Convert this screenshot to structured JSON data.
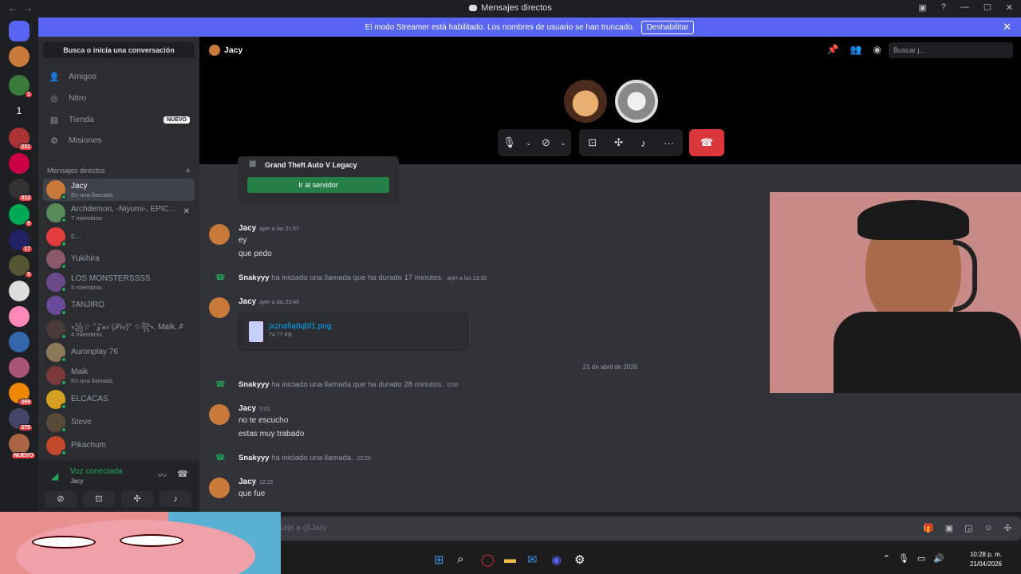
{
  "window": {
    "title": "Mensajes directos",
    "back": "←",
    "forward": "→"
  },
  "banner": {
    "text": "El modo Streamer está habilitado. Los nombres de usuario se han truncado.",
    "button": "Deshabilitar",
    "close": "✕"
  },
  "guilds": [
    {
      "badge": "",
      "color": "#5865f2"
    },
    {
      "badge": "",
      "color": "#c97a3a"
    },
    {
      "badge": "1",
      "color": "#3a7a3a"
    },
    {
      "badge": "",
      "label": "1",
      "color": "#1e1f22"
    },
    {
      "badge": "231",
      "color": "#a33"
    },
    {
      "badge": "",
      "color": "#c04"
    },
    {
      "badge": "312",
      "color": "#333"
    },
    {
      "badge": "5",
      "color": "#0a5"
    },
    {
      "badge": "17",
      "color": "#226"
    },
    {
      "badge": "5",
      "color": "#553"
    },
    {
      "badge": "",
      "color": "#ddd"
    },
    {
      "badge": "",
      "color": "#f8b"
    },
    {
      "badge": "",
      "color": "#36a"
    },
    {
      "badge": "",
      "color": "#a57"
    },
    {
      "badge": "369",
      "color": "#e80"
    },
    {
      "badge": "375",
      "color": "#446"
    },
    {
      "badge": "NUEVO",
      "color": "#a64"
    }
  ],
  "dm_sidebar": {
    "search": "Busca o inicia una conversación",
    "nav": [
      {
        "label": "Amigos",
        "icon": "person-icon"
      },
      {
        "label": "Nitro",
        "icon": "nitro-icon"
      },
      {
        "label": "Tienda",
        "icon": "shop-icon",
        "badge": "NUEVO"
      },
      {
        "label": "Misiones",
        "icon": "quests-icon"
      }
    ],
    "section": "Mensajes directos",
    "add": "+",
    "dms": [
      {
        "name": "Jacy",
        "sub": "En una llamada",
        "color": "#c97a3a",
        "active": true
      },
      {
        "name": "Archdemon, -Niyumi-, EPIC...",
        "sub": "7 miembros",
        "color": "#5a8a5a",
        "close": "✕"
      },
      {
        "name": "c...",
        "sub": "",
        "color": "#e23c3c"
      },
      {
        "name": "Yukihira",
        "sub": "",
        "color": "#8a5a6a"
      },
      {
        "name": "LOS MONSTERSSSS",
        "sub": "5 miembros",
        "color": "#6a4a8a"
      },
      {
        "name": "TANJIRO",
        "sub": "",
        "color": "#6a4a9a"
      },
      {
        "name": "꧁☆ °𝒵𝒶𝒾 (𝒮𝑒𝒾)° ☆꧂, Maik, Arc...",
        "sub": "4 miembros",
        "color": "#4a3a3a"
      },
      {
        "name": "Auronplay 76",
        "sub": "",
        "color": "#8a7a5a"
      },
      {
        "name": "Maik",
        "sub": "En una llamada",
        "color": "#7a3a3a"
      },
      {
        "name": "ELCACAS",
        "sub": "",
        "color": "#d4a020"
      },
      {
        "name": "Steve",
        "sub": "",
        "color": "#5a4a3a"
      },
      {
        "name": "Pikachum",
        "sub": "",
        "color": "#c04a2a"
      }
    ],
    "voice": {
      "status": "Voz conectada",
      "channel": "Jacy"
    }
  },
  "header": {
    "name": "Jacy",
    "search_placeholder": "Buscar j..."
  },
  "invite": {
    "game": "Grand Theft Auto V Legacy",
    "button": "Ir al servidor"
  },
  "messages": [
    {
      "type": "msg",
      "author": "Jacy",
      "time": "ayer a las 21:57",
      "lines": [
        "ey",
        "que pedo"
      ]
    },
    {
      "type": "sys",
      "author": "Snakyyy",
      "text": "ha iniciado una llamada que ha durado 17 minutos.",
      "time": "ayer a las 23:39"
    },
    {
      "type": "msg",
      "author": "Jacy",
      "time": "ayer a las 23:46",
      "file": {
        "name": "jxznafia8qbf1.png",
        "size": "74.77 KB"
      }
    },
    {
      "type": "date",
      "text": "21 de abril de 2026"
    },
    {
      "type": "sys",
      "author": "Snakyyy",
      "text": "ha iniciado una llamada que ha durado 28 minutos.",
      "time": "0:00"
    },
    {
      "type": "msg",
      "author": "Jacy",
      "time": "0:01",
      "lines": [
        "no te escucho",
        "estas muy trabado"
      ]
    },
    {
      "type": "sys",
      "author": "Snakyyy",
      "text": "ha iniciado una llamada.",
      "time": "22:20"
    },
    {
      "type": "msg",
      "author": "Jacy",
      "time": "22:21",
      "lines": [
        "que fue"
      ]
    }
  ],
  "composer": {
    "placeholder": "saje a @Jacy"
  },
  "taskbar": {
    "time": "10:28 p. m.",
    "date": "21/04/2026"
  },
  "colors": {
    "accent": "#5865f2",
    "green": "#23a55a",
    "red": "#da373c"
  }
}
